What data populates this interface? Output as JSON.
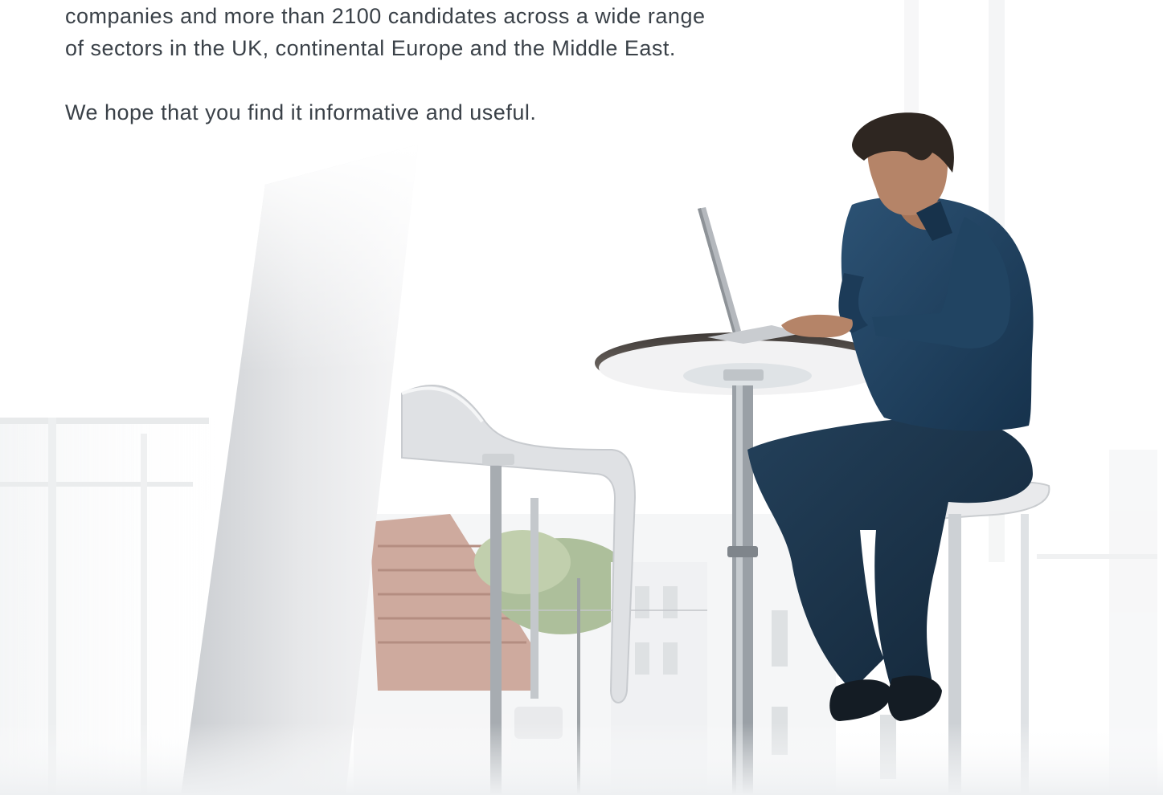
{
  "body_text": {
    "paragraph_1_line_1": "companies and more than 2100 candidates across a wide range",
    "paragraph_1_line_2": "of sectors in the UK, continental Europe and the Middle East.",
    "paragraph_2": "We hope that you find it informative and useful."
  },
  "colors": {
    "text": "#3a4148",
    "shirt": "#1f3d5e",
    "jeans": "#1b3146",
    "skin": "#b58468",
    "hair": "#2e2621",
    "table_top": "#5b5450",
    "stool": "#e3e4e6",
    "pole": "#9aa0a6"
  }
}
